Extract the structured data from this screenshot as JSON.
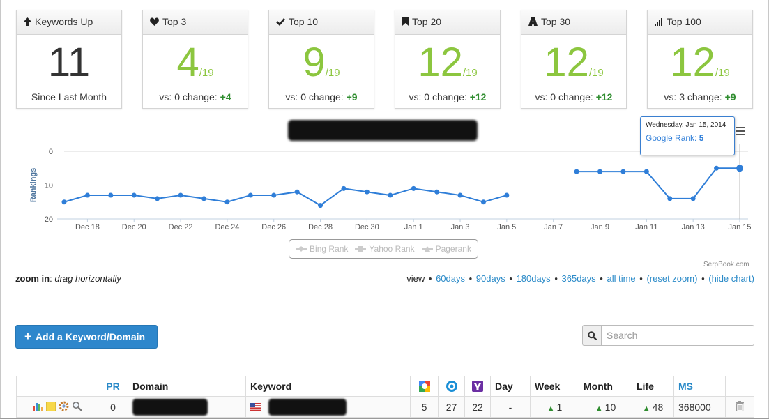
{
  "cards": [
    {
      "title": "Keywords Up",
      "icon": "arrow-up-icon",
      "value": "11",
      "total": "",
      "foot_text": "Since Last Month",
      "foot_change": ""
    },
    {
      "title": "Top 3",
      "icon": "heart-icon",
      "value": "4",
      "total": "/19",
      "foot_text": "vs: 0 change:",
      "foot_change": "+4"
    },
    {
      "title": "Top 10",
      "icon": "checkmark-icon",
      "value": "9",
      "total": "/19",
      "foot_text": "vs: 0 change:",
      "foot_change": "+9"
    },
    {
      "title": "Top 20",
      "icon": "bookmark-icon",
      "value": "12",
      "total": "/19",
      "foot_text": "vs: 0 change:",
      "foot_change": "+12"
    },
    {
      "title": "Top 30",
      "icon": "road-icon",
      "value": "12",
      "total": "/19",
      "foot_text": "vs: 0 change:",
      "foot_change": "+12"
    },
    {
      "title": "Top 100",
      "icon": "signal-bars-icon",
      "value": "12",
      "total": "/19",
      "foot_text": "vs: 3 change:",
      "foot_change": "+9"
    }
  ],
  "tooltip": {
    "date": "Wednesday, Jan 15, 2014",
    "label": "Google Rank:",
    "value": "5"
  },
  "chart_data": {
    "type": "line",
    "title": "",
    "xlabel": "",
    "ylabel": "Rankings",
    "ylim": [
      20,
      0
    ],
    "y_ticks": [
      "0",
      "10",
      "20"
    ],
    "x_tick_labels": [
      "Dec 18",
      "Dec 20",
      "Dec 22",
      "Dec 24",
      "Dec 26",
      "Dec 28",
      "Dec 30",
      "Jan 1",
      "Jan 3",
      "Jan 5",
      "Jan 7",
      "Jan 9",
      "Jan 11",
      "Jan 13",
      "Jan 15"
    ],
    "series": [
      {
        "name": "Google Rank",
        "color": "#2f7ed8",
        "x": [
          "2013-12-17",
          "2013-12-18",
          "2013-12-19",
          "2013-12-20",
          "2013-12-21",
          "2013-12-22",
          "2013-12-23",
          "2013-12-24",
          "2013-12-25",
          "2013-12-26",
          "2013-12-27",
          "2013-12-28",
          "2013-12-29",
          "2013-12-30",
          "2013-12-31",
          "2014-01-01",
          "2014-01-02",
          "2014-01-03",
          "2014-01-04",
          "2014-01-05",
          "2014-01-06",
          "2014-01-07",
          "2014-01-08",
          "2014-01-09",
          "2014-01-10",
          "2014-01-11",
          "2014-01-12",
          "2014-01-13",
          "2014-01-14",
          "2014-01-15"
        ],
        "values": [
          15,
          13,
          13,
          13,
          14,
          13,
          14,
          15,
          13,
          13,
          12,
          16,
          11,
          12,
          13,
          11,
          12,
          13,
          15,
          13,
          null,
          null,
          6,
          6,
          6,
          6,
          14,
          14,
          5,
          5
        ]
      },
      {
        "name": "Bing Rank",
        "color": "#cccccc",
        "values": []
      },
      {
        "name": "Yahoo Rank",
        "color": "#cccccc",
        "values": []
      },
      {
        "name": "Pagerank",
        "color": "#cccccc",
        "values": []
      }
    ],
    "highlight": {
      "x": "2014-01-15",
      "value": 5
    },
    "grid": true,
    "legend_position": "bottom-center"
  },
  "legend": {
    "items": [
      "Bing Rank",
      "Yahoo Rank",
      "Pagerank"
    ]
  },
  "credit": "SerpBook.com",
  "zoom_hint": {
    "label": "zoom in",
    "text": "drag horizontally"
  },
  "views": {
    "label": "view",
    "links": [
      "60days",
      "90days",
      "180days",
      "365days",
      "all time",
      "(reset zoom)",
      "(hide chart)"
    ]
  },
  "add_button": "Add a Keyword/Domain",
  "search": {
    "placeholder": "Search"
  },
  "table": {
    "headers": {
      "pr": "PR",
      "domain": "Domain",
      "keyword": "Keyword",
      "day": "Day",
      "week": "Week",
      "month": "Month",
      "life": "Life",
      "ms": "MS"
    },
    "row": {
      "pr": "0",
      "google": "5",
      "bing": "27",
      "yahoo": "22",
      "day": "-",
      "week": "1",
      "month": "10",
      "life": "48",
      "ms": "368000"
    }
  },
  "colors": {
    "green_value": "#8cc63f",
    "change_green": "#2f8d2f",
    "line_blue": "#2f7ed8",
    "button_blue": "#2e87cc"
  }
}
